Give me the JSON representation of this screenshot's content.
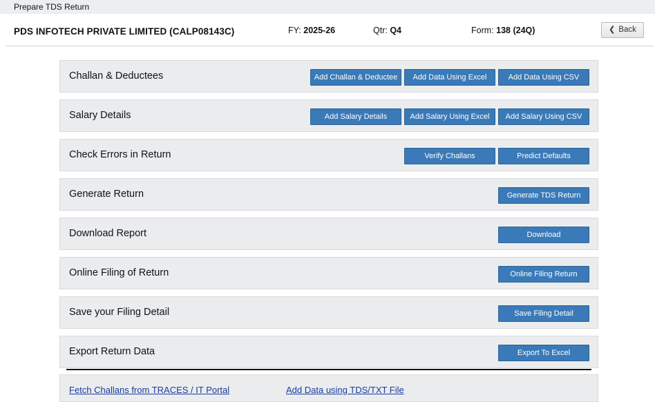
{
  "window": {
    "title": "Prepare TDS Return"
  },
  "header": {
    "company": "PDS INFOTECH PRIVATE LIMITED (CALP08143C)",
    "fy_label": "FY:",
    "fy_value": "2025-26",
    "qtr_label": "Qtr:",
    "qtr_value": "Q4",
    "form_label": "Form:",
    "form_value": "138 (24Q)",
    "back_label": "Back"
  },
  "sections": [
    {
      "label": "Challan & Deductees",
      "buttons": [
        "Add Challan & Deductee",
        "Add Data Using Excel",
        "Add Data Using CSV"
      ]
    },
    {
      "label": "Salary Details",
      "buttons": [
        "Add Salary Details",
        "Add Salary Using Excel",
        "Add Salary Using CSV"
      ]
    },
    {
      "label": "Check Errors in Return",
      "buttons": [
        "Verify Challans",
        "Predict Defaults"
      ]
    },
    {
      "label": "Generate Return",
      "buttons": [
        "Generate TDS Return"
      ]
    },
    {
      "label": "Download Report",
      "buttons": [
        "Download"
      ]
    },
    {
      "label": "Online Filing of Return",
      "buttons": [
        "Online Filing Return"
      ]
    },
    {
      "label": "Save your Filing Detail",
      "buttons": [
        "Save Filing Detail"
      ]
    },
    {
      "label": "Export Return Data",
      "buttons": [
        "Export To Excel"
      ]
    }
  ],
  "links": {
    "fetch_challans": "Fetch Challans from TRACES / IT Portal",
    "add_txt": "Add Data using TDS/TXT File"
  },
  "colors": {
    "button_bg": "#3a7ab8",
    "row_bg": "#ebecee",
    "link": "#1a3a9c"
  }
}
